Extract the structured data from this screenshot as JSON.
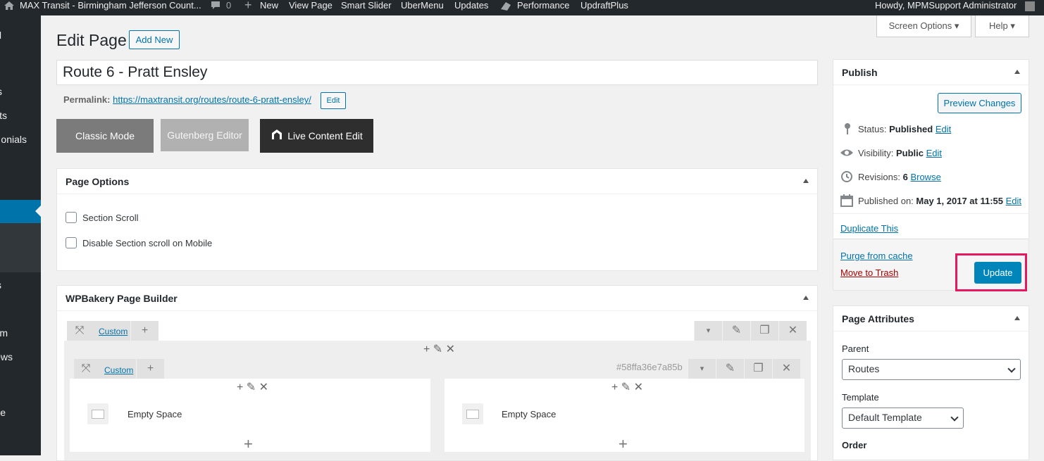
{
  "admin_bar": {
    "site_name": "MAX Transit - Birmingham Jefferson Count...",
    "comments_count": "0",
    "new_label": "New",
    "view_page": "View Page",
    "smart_slider": "Smart Slider",
    "ubermenu": "UberMenu",
    "updates": "Updates",
    "performance": "Performance",
    "updraftplus": "UpdraftPlus",
    "howdy": "Howdy, MPMSupport Administrator"
  },
  "side_menu": [
    "d",
    "s",
    "ts",
    "onials",
    "s",
    "m",
    "ews",
    "e"
  ],
  "screen_options": "Screen Options",
  "help": "Help",
  "page_title": "Edit Page",
  "add_new": "Add New",
  "post_title": "Route 6 - Pratt Ensley",
  "permalink": {
    "label": "Permalink:",
    "url": "https://maxtransit.org/routes/route-6-pratt-ensley/",
    "edit": "Edit"
  },
  "mode_buttons": {
    "classic": "Classic Mode",
    "gutenberg": "Gutenberg Editor",
    "live": "Live Content Edit"
  },
  "page_options": {
    "title": "Page Options",
    "options": [
      "Section Scroll",
      "Disable Section scroll on Mobile"
    ]
  },
  "wpbakery": {
    "title": "WPBakery Page Builder",
    "custom_label": "Custom",
    "row_id": "#58ffa36e7a85b",
    "columns": [
      {
        "element": "Empty Space"
      },
      {
        "element": "Empty Space"
      }
    ]
  },
  "publish": {
    "title": "Publish",
    "preview": "Preview Changes",
    "status_label": "Status:",
    "status_value": "Published",
    "visibility_label": "Visibility:",
    "visibility_value": "Public",
    "revisions_label": "Revisions:",
    "revisions_value": "6",
    "browse": "Browse",
    "published_label": "Published on:",
    "published_value": "May 1, 2017 at 11:55",
    "edit": "Edit",
    "duplicate": "Duplicate This",
    "purge": "Purge from cache",
    "trash": "Move to Trash",
    "update": "Update"
  },
  "page_attributes": {
    "title": "Page Attributes",
    "parent_label": "Parent",
    "parent_value": "Routes",
    "template_label": "Template",
    "template_value": "Default Template",
    "order_label": "Order"
  },
  "colors": {
    "admin_bar": "#23282d",
    "accent": "#0073aa",
    "update_button": "#0085ba",
    "highlight": "#e5175f",
    "trash": "#a00"
  }
}
